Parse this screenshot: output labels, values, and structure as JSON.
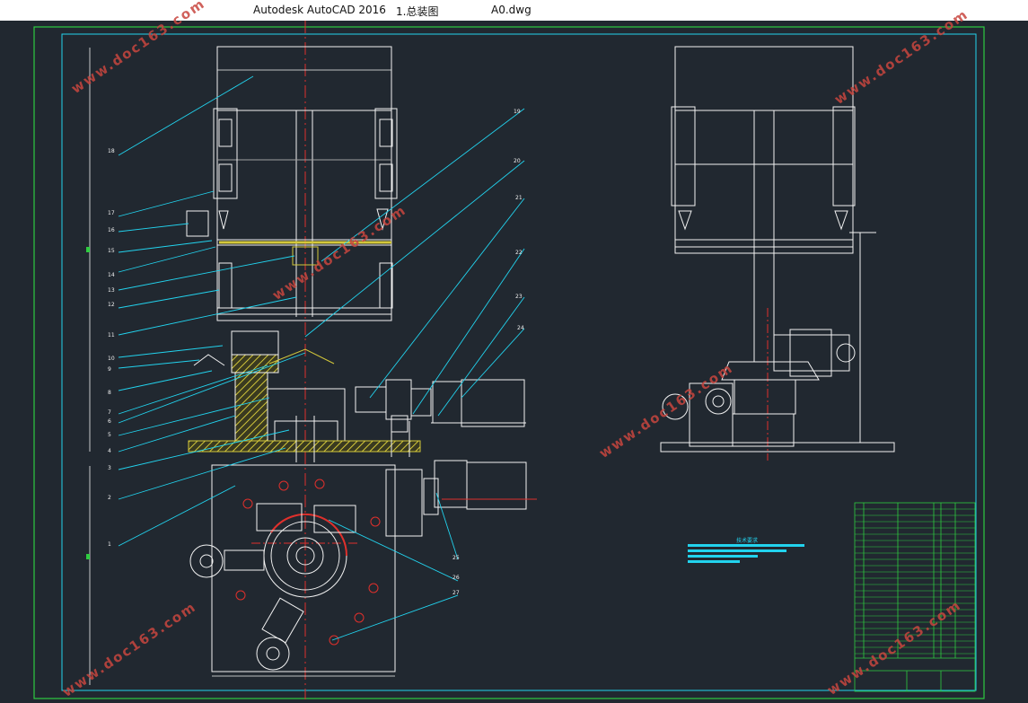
{
  "titlebar": {
    "app_name": "Autodesk AutoCAD 2016",
    "drawing_name": "1.总装图",
    "file_name": "A0.dwg"
  },
  "watermark": "www.doc163.com",
  "part_labels": [
    "18",
    "17",
    "16",
    "15",
    "14",
    "13",
    "12",
    "11",
    "10",
    "9",
    "8",
    "7",
    "6",
    "5",
    "4",
    "3",
    "2",
    "1"
  ],
  "right_labels": [
    "19",
    "20",
    "21",
    "22",
    "23",
    "24"
  ],
  "bottom_labels": [
    "25",
    "26",
    "27"
  ],
  "tech_requirements_title": "技术要求",
  "colors": {
    "background": "#212830",
    "frame_green": "#2ecc40",
    "cyan": "#22d3ee",
    "white": "#f2f2f2",
    "red_center": "#e0302c",
    "hatch_yellow": "#d4c83a"
  }
}
